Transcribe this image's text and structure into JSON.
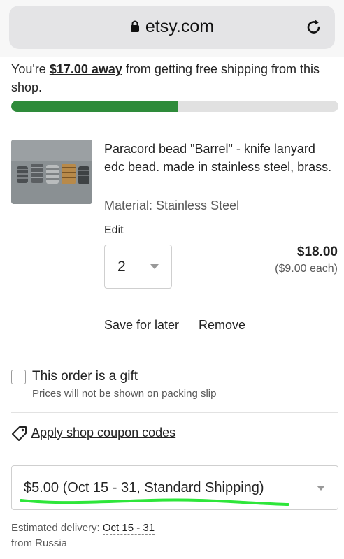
{
  "browser": {
    "url": "etsy.com"
  },
  "free_shipping": {
    "prefix": "You're ",
    "amount": "$17.00 away",
    "suffix": " from getting free shipping from this shop.",
    "progress_fraction": 0.51,
    "progress_color": "#2e8b3a"
  },
  "item": {
    "title": "Paracord bead \"Barrel\" - knife lanyard edc bead. made in stainless steel, brass.",
    "material": "Material: Stainless Steel",
    "edit_label": "Edit",
    "quantity": "2",
    "price": "$18.00",
    "price_each": "($9.00 each)",
    "save_for_later": "Save for later",
    "remove": "Remove"
  },
  "gift": {
    "label": "This order is a gift",
    "note": "Prices will not be shown on packing slip"
  },
  "coupon": {
    "label": "Apply shop coupon codes",
    "icon": "tag-icon"
  },
  "shipping": {
    "selected": "$5.00 (Oct 15 - 31, Standard Shipping)",
    "est_label": "Estimated delivery: ",
    "est_dates": "Oct 15 - 31",
    "origin": "from Russia",
    "scribble_color": "#2ee63a"
  }
}
